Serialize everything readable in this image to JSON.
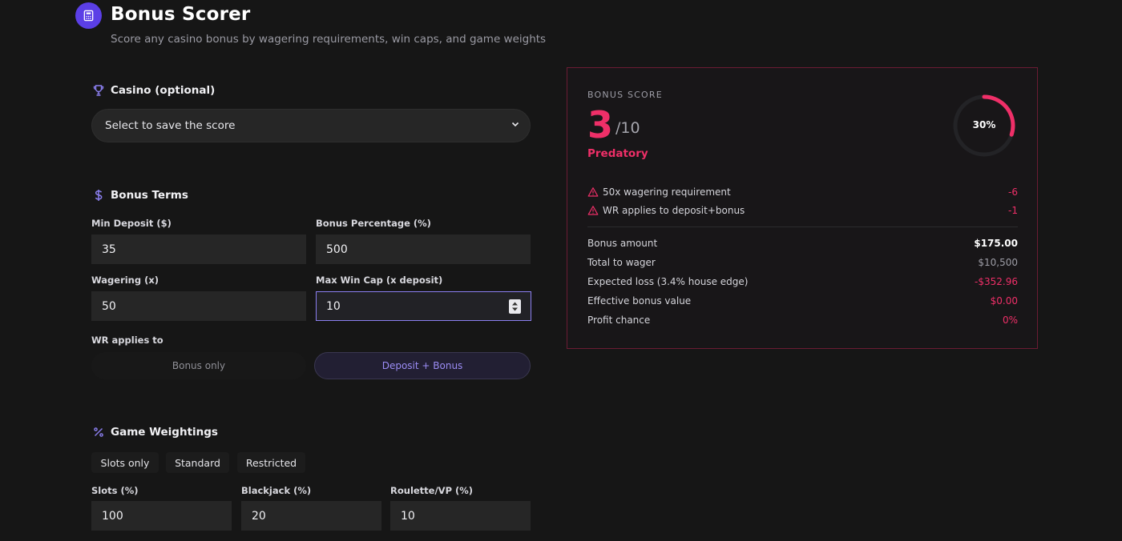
{
  "header": {
    "title": "Bonus Scorer",
    "subtitle": "Score any casino bonus by wagering requirements, win caps, and game weights"
  },
  "casino": {
    "heading": "Casino (optional)",
    "select_value": "Select to save the score"
  },
  "terms": {
    "heading": "Bonus Terms",
    "min_deposit_label": "Min Deposit ($)",
    "min_deposit_value": "35",
    "bonus_pct_label": "Bonus Percentage (%)",
    "bonus_pct_value": "500",
    "wagering_label": "Wagering (x)",
    "wagering_value": "50",
    "max_win_label": "Max Win Cap (x deposit)",
    "max_win_value": "10",
    "wr_applies_label": "WR applies to",
    "wr_options": [
      "Bonus only",
      "Deposit + Bonus"
    ],
    "wr_selected": "Deposit + Bonus"
  },
  "weights": {
    "heading": "Game Weightings",
    "presets": [
      "Slots only",
      "Standard",
      "Restricted"
    ],
    "slots_label": "Slots (%)",
    "slots_value": "100",
    "blackjack_label": "Blackjack (%)",
    "blackjack_value": "20",
    "roulette_label": "Roulette/VP (%)",
    "roulette_value": "10"
  },
  "score": {
    "label": "BONUS SCORE",
    "value": "3",
    "max": "/10",
    "rating": "Predatory",
    "gauge_text": "30%",
    "gauge_fraction": 0.3,
    "penalties": [
      {
        "text": "50x wagering requirement",
        "value": "-6"
      },
      {
        "text": "WR applies to deposit+bonus",
        "value": "-1"
      }
    ],
    "stats": [
      {
        "label": "Bonus amount",
        "value": "$175.00",
        "color": "#ffffff"
      },
      {
        "label": "Total to wager",
        "value": "$10,500",
        "color": "#9d9da6"
      },
      {
        "label": "Expected loss (3.4% house edge)",
        "value": "-$352.96",
        "color": "#ef2f68"
      },
      {
        "label": "Effective bonus value",
        "value": "$0.00",
        "color": "#ef2f68"
      },
      {
        "label": "Profit chance",
        "value": "0%",
        "color": "#ef2f68"
      }
    ]
  },
  "colors": {
    "accent": "#5b3fe6",
    "danger": "#ef2f68",
    "card_border": "#6b1c33"
  }
}
